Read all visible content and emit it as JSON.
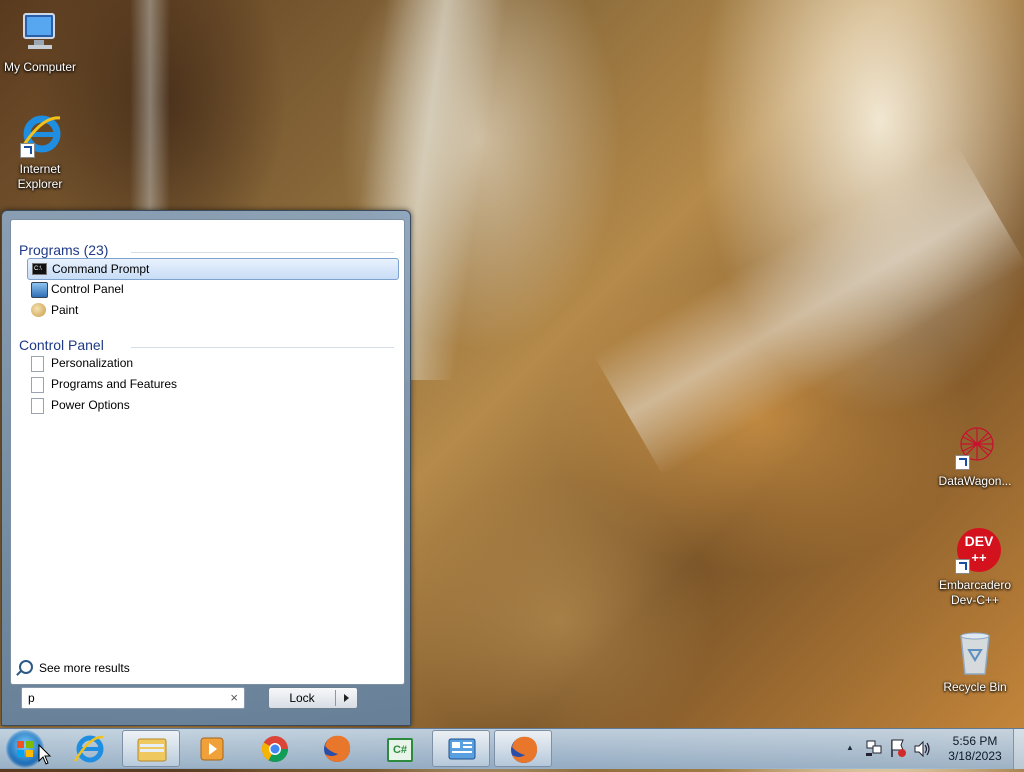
{
  "desktop": {
    "icons": [
      {
        "label": "My Computer"
      },
      {
        "label": "Internet Explorer"
      },
      {
        "label": "DataWagon..."
      },
      {
        "label": "Embarcadero Dev-C++"
      },
      {
        "label": "Recycle Bin"
      }
    ],
    "devcpp_badge": "DEV",
    "devcpp_plus": "++"
  },
  "start_menu": {
    "programs_header": "Programs (23)",
    "programs": [
      {
        "label": "Command Prompt",
        "icon": "cmd-icon"
      },
      {
        "label": "Control Panel",
        "icon": "control-panel-icon"
      },
      {
        "label": "Paint",
        "icon": "paint-icon"
      }
    ],
    "control_panel_header": "Control Panel",
    "control_panel_items": [
      {
        "label": "Personalization",
        "icon": "document-icon"
      },
      {
        "label": "Programs and Features",
        "icon": "document-icon"
      },
      {
        "label": "Power Options",
        "icon": "document-icon"
      }
    ],
    "see_more": "See more results",
    "search_value": "p",
    "clear_glyph": "×",
    "lock_label": "Lock",
    "cmd_glyph": "C:\\"
  },
  "taskbar": {
    "clock_time": "5:56 PM",
    "clock_date": "3/18/2023",
    "csharp_glyph": "C#",
    "up_arrow": "▲",
    "colors": {
      "accent": "#1e6fb8",
      "selection": "#c7dcf6"
    }
  }
}
